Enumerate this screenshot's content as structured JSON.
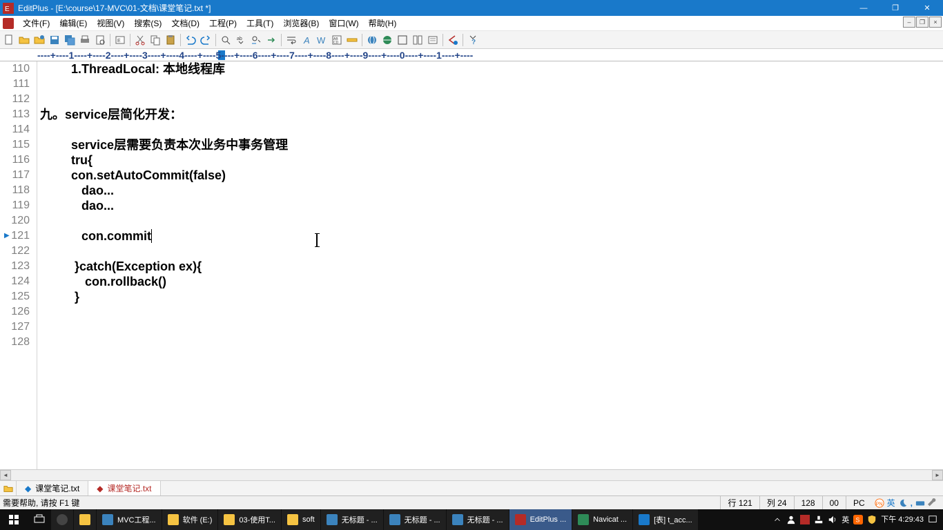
{
  "title": "EditPlus - [E:\\course\\17-MVC\\01-文档\\课堂笔记.txt *]",
  "menu": [
    "文件(F)",
    "编辑(E)",
    "视图(V)",
    "搜索(S)",
    "文档(D)",
    "工程(P)",
    "工具(T)",
    "浏览器(B)",
    "窗口(W)",
    "帮助(H)"
  ],
  "ruler_text": "----+----1----+----2----+----3----+----4----+----5----+----6----+----7----+----8----+----9----+----0----+----1----+----",
  "lines": {
    "start": 110,
    "current": 121,
    "rows": [
      "         1.ThreadLocal: 本地线程库",
      "",
      "",
      "九。service层简化开发：",
      "",
      "         service层需要负责本次业务中事务管理",
      "         tru{",
      "         con.setAutoCommit(false)",
      "            dao...",
      "            dao...",
      "",
      "            con.commit",
      "",
      "          }catch(Exception ex){",
      "             con.rollback()",
      "          }",
      "",
      "",
      ""
    ]
  },
  "tabs": [
    {
      "label": "课堂笔记.txt",
      "active": false
    },
    {
      "label": "课堂笔记.txt",
      "active": true
    }
  ],
  "status": {
    "msg": "需要帮助, 请按 F1 键",
    "line_label": "行",
    "line": "121",
    "col_label": "列",
    "col": "24",
    "total": "128",
    "sel": "00",
    "mode": "PC"
  },
  "taskbar": {
    "items": [
      {
        "label": "",
        "cls": "ico-firefox"
      },
      {
        "label": "",
        "cls": "ico-folder"
      },
      {
        "label": "MVC工程...",
        "cls": "ico-paint"
      },
      {
        "label": "软件 (E:)",
        "cls": "ico-folder"
      },
      {
        "label": "03-使用T...",
        "cls": "ico-folder"
      },
      {
        "label": "soft",
        "cls": "ico-folder"
      },
      {
        "label": "无标题 - ...",
        "cls": "ico-paint"
      },
      {
        "label": "无标题 - ...",
        "cls": "ico-paint"
      },
      {
        "label": "无标题 - ...",
        "cls": "ico-paint"
      },
      {
        "label": "EditPlus ...",
        "cls": "ico-red",
        "active": true
      },
      {
        "label": "Navicat ...",
        "cls": "ico-green"
      },
      {
        "label": "[表] t_acc...",
        "cls": "ico-blue"
      }
    ],
    "ime": "英",
    "time": "下午 4:29:43"
  }
}
